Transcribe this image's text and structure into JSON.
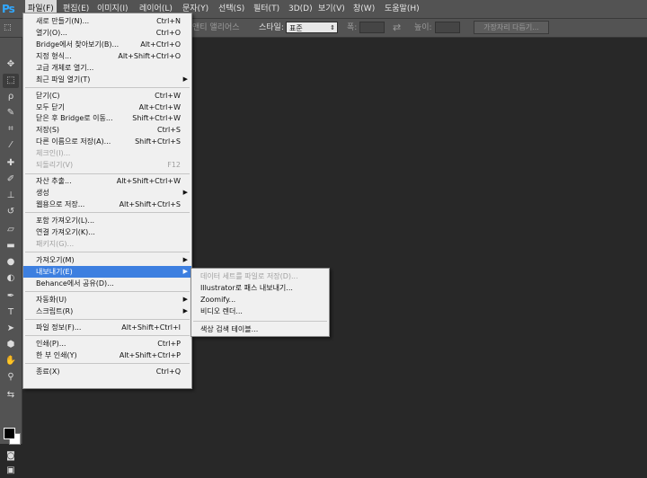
{
  "app": {
    "logo": "Ps"
  },
  "menubar": [
    {
      "label": "파일(F)",
      "active": true
    },
    {
      "label": "편집(E)"
    },
    {
      "label": "이미지(I)"
    },
    {
      "label": "레이어(L)"
    },
    {
      "label": "문자(Y)"
    },
    {
      "label": "선택(S)"
    },
    {
      "label": "필터(T)"
    },
    {
      "label": "3D(D)"
    },
    {
      "label": "보기(V)"
    },
    {
      "label": "창(W)"
    },
    {
      "label": "도움말(H)"
    }
  ],
  "options": {
    "partial_label": "앤티 앨리어스",
    "style_label": "스타일:",
    "style_value": "표준",
    "width_label": "폭:",
    "height_label": "높이:",
    "refine_button": "가장자리 다듬기..."
  },
  "file_menu": [
    {
      "label": "새로 만들기(N)...",
      "shortcut": "Ctrl+N"
    },
    {
      "label": "열기(O)...",
      "shortcut": "Ctrl+O"
    },
    {
      "label": "Bridge에서 찾아보기(B)...",
      "shortcut": "Alt+Ctrl+O"
    },
    {
      "label": "지정 형식...",
      "shortcut": "Alt+Shift+Ctrl+O"
    },
    {
      "label": "고급 개체로 열기..."
    },
    {
      "label": "최근 파일 열기(T)",
      "submenu": true
    },
    {
      "sep": true
    },
    {
      "label": "닫기(C)",
      "shortcut": "Ctrl+W"
    },
    {
      "label": "모두 닫기",
      "shortcut": "Alt+Ctrl+W"
    },
    {
      "label": "닫은 후 Bridge로 이동...",
      "shortcut": "Shift+Ctrl+W"
    },
    {
      "label": "저장(S)",
      "shortcut": "Ctrl+S"
    },
    {
      "label": "다른 이름으로 저장(A)...",
      "shortcut": "Shift+Ctrl+S"
    },
    {
      "label": "체크인(I)...",
      "disabled": true
    },
    {
      "label": "되돌리기(V)",
      "shortcut": "F12",
      "disabled": true
    },
    {
      "sep": true
    },
    {
      "label": "자산 추출...",
      "shortcut": "Alt+Shift+Ctrl+W"
    },
    {
      "label": "생성",
      "submenu": true
    },
    {
      "label": "웹용으로 저장...",
      "shortcut": "Alt+Shift+Ctrl+S"
    },
    {
      "sep": true
    },
    {
      "label": "포함 가져오기(L)..."
    },
    {
      "label": "연결 가져오기(K)..."
    },
    {
      "label": "패키지(G)...",
      "disabled": true
    },
    {
      "sep": true
    },
    {
      "label": "가져오기(M)",
      "submenu": true
    },
    {
      "label": "내보내기(E)",
      "submenu": true,
      "highlighted": true
    },
    {
      "label": "Behance에서 공유(D)..."
    },
    {
      "sep": true
    },
    {
      "label": "자동화(U)",
      "submenu": true
    },
    {
      "label": "스크립트(R)",
      "submenu": true
    },
    {
      "sep": true
    },
    {
      "label": "파일 정보(F)...",
      "shortcut": "Alt+Shift+Ctrl+I"
    },
    {
      "sep": true
    },
    {
      "label": "인쇄(P)...",
      "shortcut": "Ctrl+P"
    },
    {
      "label": "한 부 인쇄(Y)",
      "shortcut": "Alt+Shift+Ctrl+P"
    },
    {
      "sep": true
    },
    {
      "label": "종료(X)",
      "shortcut": "Ctrl+Q"
    }
  ],
  "export_submenu": [
    {
      "label": "데이터 세트를 파일로 저장(D)...",
      "disabled": true
    },
    {
      "label": "Illustrator로 패스 내보내기..."
    },
    {
      "label": "Zoomify..."
    },
    {
      "label": "비디오 렌더..."
    },
    {
      "sep": true
    },
    {
      "label": "색상 검색 테이블..."
    }
  ],
  "tools": [
    {
      "icon": "move-tool-icon",
      "glyph": "✥"
    },
    {
      "icon": "marquee-tool-icon",
      "glyph": "⬚",
      "selected": true
    },
    {
      "icon": "lasso-tool-icon",
      "glyph": "ρ"
    },
    {
      "icon": "quick-select-tool-icon",
      "glyph": "✎"
    },
    {
      "icon": "crop-tool-icon",
      "glyph": "⌗"
    },
    {
      "icon": "eyedropper-tool-icon",
      "glyph": "⁄"
    },
    {
      "icon": "healing-brush-tool-icon",
      "glyph": "✚"
    },
    {
      "icon": "brush-tool-icon",
      "glyph": "✐"
    },
    {
      "icon": "clone-stamp-tool-icon",
      "glyph": "⊥"
    },
    {
      "icon": "history-brush-tool-icon",
      "glyph": "↺"
    },
    {
      "icon": "eraser-tool-icon",
      "glyph": "▱"
    },
    {
      "icon": "gradient-tool-icon",
      "glyph": "▬"
    },
    {
      "icon": "blur-tool-icon",
      "glyph": "●"
    },
    {
      "icon": "dodge-tool-icon",
      "glyph": "◐"
    },
    {
      "icon": "pen-tool-icon",
      "glyph": "✒"
    },
    {
      "icon": "type-tool-icon",
      "glyph": "T"
    },
    {
      "icon": "path-select-tool-icon",
      "glyph": "➤"
    },
    {
      "icon": "shape-tool-icon",
      "glyph": "⬢"
    },
    {
      "icon": "hand-tool-icon",
      "glyph": "✋"
    },
    {
      "icon": "zoom-tool-icon",
      "glyph": "⚲"
    },
    {
      "icon": "swap-colors-icon",
      "glyph": "⇆"
    }
  ],
  "colors": {
    "accent": "#3d7fe0",
    "menubar": "#535353",
    "canvas": "#282828",
    "menu_bg": "#f0f0f0"
  }
}
